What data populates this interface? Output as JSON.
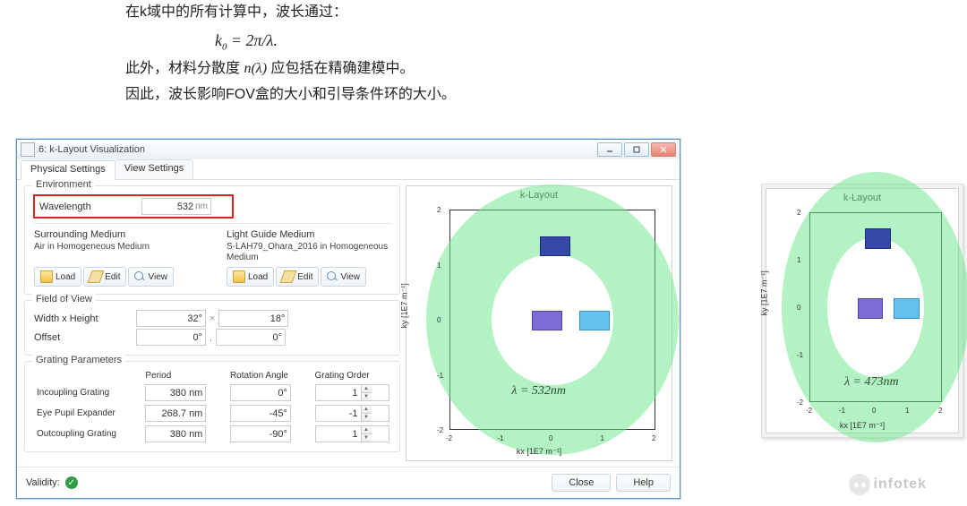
{
  "intro": {
    "line1": "在k域中的所有计算中，波长通过：",
    "formula_html": "k<span class='sub'>0</span> = 2π/λ.",
    "line2_a": "此外，材料分散度 ",
    "line2_n": "n(λ)",
    "line2_b": " 应包括在精确建模中。",
    "line3": "因此，波长影响FOV盒的大小和引导条件环的大小。"
  },
  "formula_overlay": "n(λ)",
  "window": {
    "title": "6: k-Layout Visualization",
    "tabs": [
      "Physical Settings",
      "View Settings"
    ],
    "active_tab": 0,
    "environment": {
      "legend": "Environment",
      "wavelength_label": "Wavelength",
      "wavelength_value": "532",
      "wavelength_unit": "nm",
      "surrounding_title": "Surrounding Medium",
      "surrounding_value": "Air in Homogeneous Medium",
      "lightguide_title": "Light Guide Medium",
      "lightguide_value": "S-LAH79_Ohara_2016 in Homogeneous Medium",
      "btn_load": "Load",
      "btn_edit": "Edit",
      "btn_view": "View"
    },
    "fov": {
      "legend": "Field of View",
      "wh_label": "Width x Height",
      "width": "32°",
      "height": "18°",
      "offset_label": "Offset",
      "offx": "0°",
      "offy": "0°"
    },
    "gratings": {
      "legend": "Grating Parameters",
      "col_period": "Period",
      "col_rot": "Rotation Angle",
      "col_order": "Grating Order",
      "rows": [
        {
          "name": "Incoupling Grating",
          "period": "380 nm",
          "rot": "0°",
          "order": "1"
        },
        {
          "name": "Eye Pupil Expander",
          "period": "268.7 nm",
          "rot": "-45°",
          "order": "-1"
        },
        {
          "name": "Outcoupling Grating",
          "period": "380 nm",
          "rot": "-90°",
          "order": "1"
        }
      ]
    },
    "validity_label": "Validity:",
    "btn_close": "Close",
    "btn_help": "Help"
  },
  "plot_main": {
    "title": "k-Layout",
    "xlabel": "kx [1E7 m⁻¹]",
    "ylabel": "ky [1E7 m⁻¹]",
    "ticks": [
      "-2",
      "-1",
      "0",
      "1",
      "2"
    ],
    "lambda": "λ = 532nm"
  },
  "plot_side": {
    "title": "k-Layout",
    "xlabel": "kx [1E7 m⁻¹]",
    "ylabel": "ky [1E7 m⁻¹]",
    "ticks": [
      "-2",
      "-1",
      "0",
      "1",
      "2"
    ],
    "lambda": "λ = 473nm"
  },
  "watermark": "infotek"
}
